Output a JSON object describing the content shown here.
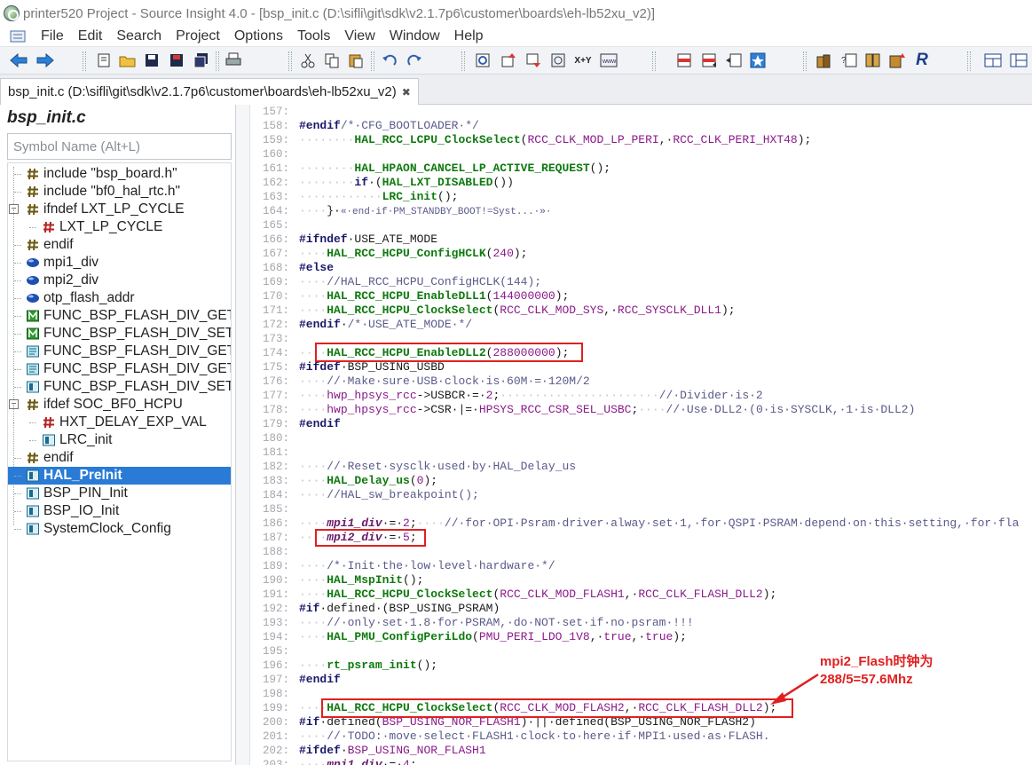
{
  "window": {
    "title": "printer520 Project - Source Insight 4.0 - [bsp_init.c (D:\\sifli\\git\\sdk\\v2.1.7p6\\customer\\boards\\eh-lb52xu_v2)]"
  },
  "menu": [
    "File",
    "Edit",
    "Search",
    "Project",
    "Options",
    "Tools",
    "View",
    "Window",
    "Help"
  ],
  "tab": {
    "label": "bsp_init.c (D:\\sifli\\git\\sdk\\v2.1.7p6\\customer\\boards\\eh-lb52xu_v2)",
    "close": "✖"
  },
  "sidebar": {
    "title": "bsp_init.c",
    "search_placeholder": "Symbol Name (Alt+L)",
    "items": [
      {
        "label": "include \"bsp_board.h\"",
        "icon": "include-icon",
        "indent": 1
      },
      {
        "label": "include \"bf0_hal_rtc.h\"",
        "icon": "include-icon",
        "indent": 1
      },
      {
        "label": "ifndef LXT_LP_CYCLE",
        "icon": "include-icon",
        "indent": 0,
        "expander": "−"
      },
      {
        "label": "LXT_LP_CYCLE",
        "icon": "define-red-icon",
        "indent": 2
      },
      {
        "label": "endif",
        "icon": "include-icon",
        "indent": 1
      },
      {
        "label": "mpi1_div",
        "icon": "variable-icon",
        "indent": 1
      },
      {
        "label": "mpi2_div",
        "icon": "variable-icon",
        "indent": 1
      },
      {
        "label": "otp_flash_addr",
        "icon": "variable-icon",
        "indent": 1
      },
      {
        "label": "FUNC_BSP_FLASH_DIV_GET",
        "icon": "macro-icon",
        "indent": 1
      },
      {
        "label": "FUNC_BSP_FLASH_DIV_SET",
        "icon": "macro-icon",
        "indent": 1
      },
      {
        "label": "FUNC_BSP_FLASH_DIV_GET",
        "icon": "function-proto-icon",
        "indent": 1
      },
      {
        "label": "FUNC_BSP_FLASH_DIV_GET",
        "icon": "function-proto-icon",
        "indent": 1
      },
      {
        "label": "FUNC_BSP_FLASH_DIV_SET",
        "icon": "function-icon",
        "indent": 1
      },
      {
        "label": "ifdef SOC_BF0_HCPU",
        "icon": "include-icon",
        "indent": 0,
        "expander": "−"
      },
      {
        "label": "HXT_DELAY_EXP_VAL",
        "icon": "define-red-icon",
        "indent": 2
      },
      {
        "label": "LRC_init",
        "icon": "function-icon",
        "indent": 2
      },
      {
        "label": "endif",
        "icon": "include-icon",
        "indent": 1
      },
      {
        "label": "HAL_PreInit",
        "icon": "function-icon",
        "indent": 1,
        "selected": true
      },
      {
        "label": "BSP_PIN_Init",
        "icon": "function-icon",
        "indent": 1
      },
      {
        "label": "BSP_IO_Init",
        "icon": "function-icon",
        "indent": 1
      },
      {
        "label": "SystemClock_Config",
        "icon": "function-icon",
        "indent": 1
      }
    ]
  },
  "editor": {
    "lines": [
      {
        "n": "157:",
        "html": ""
      },
      {
        "n": "158:",
        "html": "<span class=\"kw\">#endif</span><span class=\"cm\">/*·CFG_BOOTLOADER·*/</span>"
      },
      {
        "n": "159:",
        "html": "<span class=\"dot\">········</span><span class=\"fn\">HAL_RCC_LCPU_ClockSelect</span>(<span class=\"mac\">RCC_CLK_MOD_LP_PERI</span>,·<span class=\"mac\">RCC_CLK_PERI_HXT48</span>);"
      },
      {
        "n": "160:",
        "html": ""
      },
      {
        "n": "161:",
        "html": "<span class=\"dot\">········</span><span class=\"fn\">HAL_HPAON_CANCEL_LP_ACTIVE_REQUEST</span>();"
      },
      {
        "n": "162:",
        "html": "<span class=\"dot\">········</span><span class=\"kw\">if</span>·(<span class=\"fn\">HAL_LXT_DISABLED</span>())"
      },
      {
        "n": "163:",
        "html": "<span class=\"dot\">············</span><span class=\"fn\">LRC_init</span>();"
      },
      {
        "n": "164:",
        "html": "<span class=\"dot\">····</span>}·<span class=\"cm\" style=\"font-size:11px\">«·end·if·PM_STANDBY_BOOT!=Syst...·»·</span>"
      },
      {
        "n": "165:",
        "html": ""
      },
      {
        "n": "166:",
        "html": "<span class=\"kw\">#ifndef</span>·USE_ATE_MODE"
      },
      {
        "n": "167:",
        "html": "<span class=\"dot\">····</span><span class=\"fn\">HAL_RCC_HCPU_ConfigHCLK</span>(<span class=\"num\">240</span>);"
      },
      {
        "n": "168:",
        "html": "<span class=\"kw\">#else</span>"
      },
      {
        "n": "169:",
        "html": "<span class=\"dot\">····</span><span class=\"cm\">//HAL_RCC_HCPU_ConfigHCLK(144);</span>"
      },
      {
        "n": "170:",
        "html": "<span class=\"dot\">····</span><span class=\"fn\">HAL_RCC_HCPU_EnableDLL1</span>(<span class=\"num\">144000000</span>);"
      },
      {
        "n": "171:",
        "html": "<span class=\"dot\">····</span><span class=\"fn\">HAL_RCC_HCPU_ClockSelect</span>(<span class=\"mac\">RCC_CLK_MOD_SYS</span>,·<span class=\"mac\">RCC_SYSCLK_DLL1</span>);"
      },
      {
        "n": "172:",
        "html": "<span class=\"kw\">#endif</span>·<span class=\"cm\">/*·USE_ATE_MODE·*/</span>"
      },
      {
        "n": "173:",
        "html": ""
      },
      {
        "n": "174:",
        "html": "<span class=\"dot\">····</span><span class=\"fn\">HAL_RCC_HCPU_EnableDLL2</span>(<span class=\"num\">288000000</span>);"
      },
      {
        "n": "175:",
        "html": "<span class=\"kw\">#ifdef</span>·BSP_USING_USBD"
      },
      {
        "n": "176:",
        "html": "<span class=\"dot\">····</span><span class=\"cm\">//·Make·sure·USB·clock·is·60M·=·120M/2</span>"
      },
      {
        "n": "177:",
        "html": "<span class=\"dot\">····</span><span class=\"mac\">hwp_hpsys_rcc</span>-&gt;USBCR·=·<span class=\"num\">2</span>;<span class=\"dot\">·······················</span><span class=\"cm\">//·Divider·is·2</span>"
      },
      {
        "n": "178:",
        "html": "<span class=\"dot\">····</span><span class=\"mac\">hwp_hpsys_rcc</span>-&gt;CSR·|=·<span class=\"mac\">HPSYS_RCC_CSR_SEL_USBC</span>;<span class=\"dot\">····</span><span class=\"cm\">//·Use·DLL2·(0·is·SYSCLK,·1·is·DLL2)</span>"
      },
      {
        "n": "179:",
        "html": "<span class=\"kw\">#endif</span>"
      },
      {
        "n": "180:",
        "html": ""
      },
      {
        "n": "181:",
        "html": ""
      },
      {
        "n": "182:",
        "html": "<span class=\"dot\">····</span><span class=\"cm\">//·Reset·sysclk·used·by·HAL_Delay_us</span>"
      },
      {
        "n": "183:",
        "html": "<span class=\"dot\">····</span><span class=\"fn\">HAL_Delay_us</span>(<span class=\"num\">0</span>);"
      },
      {
        "n": "184:",
        "html": "<span class=\"dot\">····</span><span class=\"cm\">//HAL_sw_breakpoint();</span>"
      },
      {
        "n": "185:",
        "html": ""
      },
      {
        "n": "186:",
        "html": "<span class=\"dot\">····</span><span class=\"varb\">mpi1_div</span>·=·<span class=\"num\">2</span>;<span class=\"dot\">····</span><span class=\"cm\">//·for·OPI·Psram·driver·alway·set·1,·for·QSPI·PSRAM·depend·on·this·setting,·for·fla</span>"
      },
      {
        "n": "187:",
        "html": "<span class=\"dot\">····</span><span class=\"varb\">mpi2_div</span>·=·<span class=\"num\">5</span>;"
      },
      {
        "n": "188:",
        "html": ""
      },
      {
        "n": "189:",
        "html": "<span class=\"dot\">····</span><span class=\"cm\">/*·Init·the·low·level·hardware·*/</span>"
      },
      {
        "n": "190:",
        "html": "<span class=\"dot\">····</span><span class=\"fn\">HAL_MspInit</span>();"
      },
      {
        "n": "191:",
        "html": "<span class=\"dot\">····</span><span class=\"fn\">HAL_RCC_HCPU_ClockSelect</span>(<span class=\"mac\">RCC_CLK_MOD_FLASH1</span>,·<span class=\"mac\">RCC_CLK_FLASH_DLL2</span>);"
      },
      {
        "n": "192:",
        "html": "<span class=\"kw\">#if</span>·defined·(BSP_USING_PSRAM)"
      },
      {
        "n": "193:",
        "html": "<span class=\"dot\">····</span><span class=\"cm\">//·only·set·1.8·for·PSRAM,·do·NOT·set·if·no·psram·!!!</span>"
      },
      {
        "n": "194:",
        "html": "<span class=\"dot\">····</span><span class=\"fn\">HAL_PMU_ConfigPeriLdo</span>(<span class=\"mac\">PMU_PERI_LDO_1V8</span>,·<span class=\"num\">true</span>,·<span class=\"num\">true</span>);"
      },
      {
        "n": "195:",
        "html": ""
      },
      {
        "n": "196:",
        "html": "<span class=\"dot\">····</span><span class=\"fn\">rt_psram_init</span>();"
      },
      {
        "n": "197:",
        "html": "<span class=\"kw\">#endif</span>"
      },
      {
        "n": "198:",
        "html": ""
      },
      {
        "n": "199:",
        "html": "<span class=\"dot\">····</span><span class=\"fn\">HAL_RCC_HCPU_ClockSelect</span>(<span class=\"mac\">RCC_CLK_MOD_FLASH2</span>,·<span class=\"mac\">RCC_CLK_FLASH_DLL2</span>);"
      },
      {
        "n": "200:",
        "html": "<span class=\"kw\">#if</span>·defined(<span class=\"mac\">BSP_USING_NOR_FLASH1</span>)·||·defined(BSP_USING_NOR_FLASH2)"
      },
      {
        "n": "201:",
        "html": "<span class=\"dot\">····</span><span class=\"cm\">//·TODO:·move·select·FLASH1·clock·to·here·if·MPI1·used·as·FLASH.</span>"
      },
      {
        "n": "202:",
        "html": "<span class=\"kw\">#ifdef</span>·<span class=\"mac\">BSP_USING_NOR_FLASH1</span>"
      },
      {
        "n": "203:",
        "html": "<span class=\"dot\">····</span><span class=\"varb\">mpi1_div</span>·=·<span class=\"num\">4</span>;"
      }
    ]
  },
  "annotation": {
    "line1": "mpi2_Flash时钟为",
    "line2": "288/5=57.6Mhz"
  },
  "colors": {
    "highlight_box": "#e02020",
    "selection": "#2a7bd6",
    "function": "#0e7a0e",
    "keyword": "#1a1a6b",
    "macro": "#8a1a8a",
    "comment": "#5a5a8a"
  }
}
